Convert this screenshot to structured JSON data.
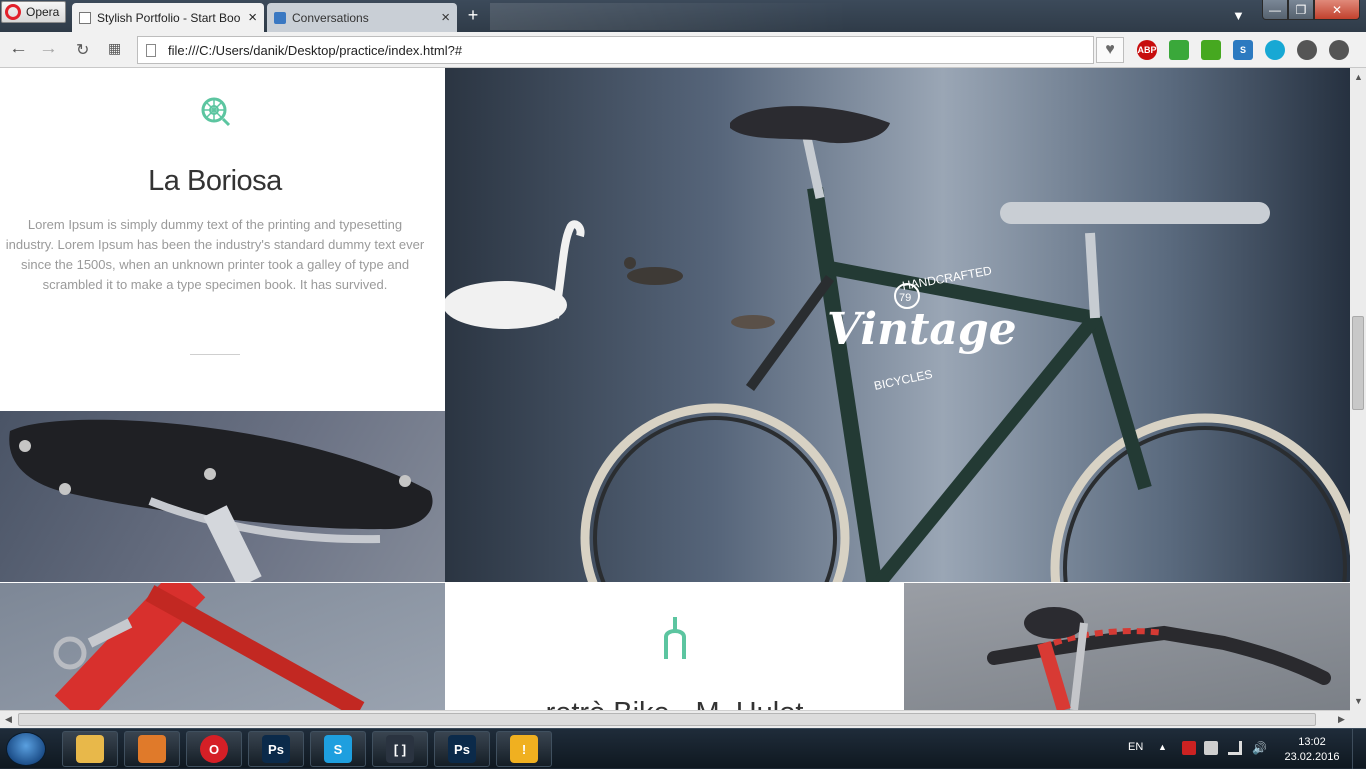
{
  "browser": {
    "menu_label": "Opera",
    "tabs": [
      {
        "title": "Stylish Portfolio - Start Boo",
        "close": "×"
      },
      {
        "title": "Conversations",
        "close": "×"
      }
    ],
    "new_tab": "+",
    "address": "file:///C:/Users/danik/Desktop/practice/index.html?#",
    "extensions": [
      {
        "name": "adblock-plus",
        "label": "ABP",
        "color": "#c70d0d"
      },
      {
        "name": "download-green",
        "label": "",
        "color": "#3aa83a"
      },
      {
        "name": "download-arrow",
        "label": "",
        "color": "#46a820"
      },
      {
        "name": "s-blue",
        "label": "S",
        "color": "#2c7ac0"
      },
      {
        "name": "circle-cyan",
        "label": "",
        "color": "#17a8d4"
      },
      {
        "name": "download-manager",
        "label": "",
        "color": "#555555"
      },
      {
        "name": "profile",
        "label": "",
        "color": "#555555"
      }
    ]
  },
  "page": {
    "about": {
      "title": "La Boriosa",
      "text": "Lorem Ipsum is simply dummy text of the printing and typesetting industry. Lorem Ipsum has been the industry's standard dummy text ever since the 1500s, when an unknown printer took a galley of type and scrambled it to make a type specimen book. It has survived."
    },
    "hero": {
      "badge_top": "HANDCRAFTED",
      "badge_number": "79",
      "badge_word": "Vintage",
      "badge_bottom": "BICYCLES"
    },
    "service": {
      "title": "retrò Bike - M. Hulot"
    },
    "accent_color": "#5cc5a0"
  },
  "taskbar": {
    "language": "EN",
    "time": "13:02",
    "date": "23.02.2016",
    "apps": [
      {
        "name": "explorer",
        "label": "",
        "color": "#e8b84a"
      },
      {
        "name": "media-player",
        "label": "",
        "color": "#e07a2a"
      },
      {
        "name": "opera",
        "label": "O",
        "color": "#d51f26"
      },
      {
        "name": "photoshop",
        "label": "Ps",
        "color": "#0b2a4a"
      },
      {
        "name": "skype",
        "label": "S",
        "color": "#1e9fdf"
      },
      {
        "name": "brackets",
        "label": "[ ]",
        "color": "#2a3340"
      },
      {
        "name": "photoshop-2",
        "label": "Ps",
        "color": "#0b2a4a"
      },
      {
        "name": "warning",
        "label": "!",
        "color": "#f0b020"
      }
    ]
  }
}
